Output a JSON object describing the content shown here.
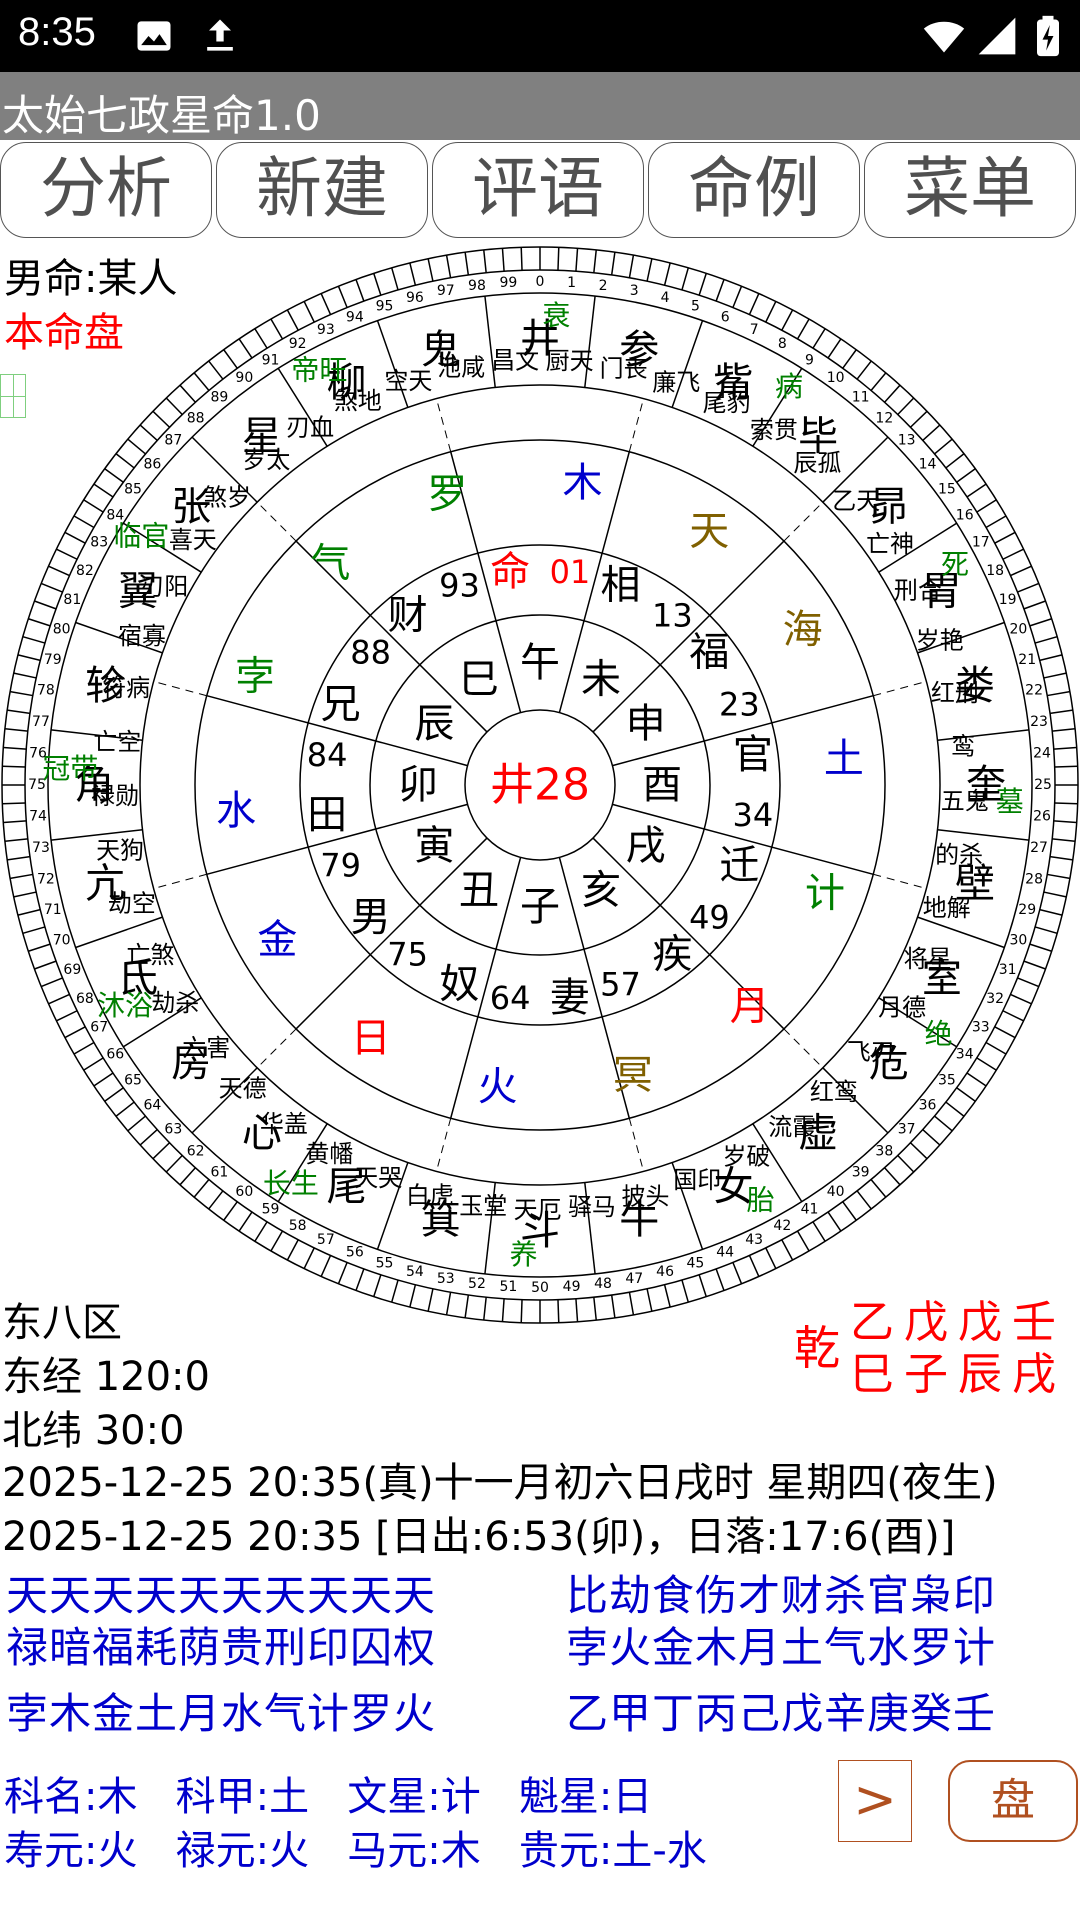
{
  "status_bar": {
    "time": "8:35",
    "icons": [
      "image-icon",
      "upload-icon",
      "wifi-icon",
      "signal-icon",
      "battery-icon"
    ]
  },
  "app": {
    "title": "太始七政星命1.0"
  },
  "tabs": [
    {
      "label": "分析"
    },
    {
      "label": "新建"
    },
    {
      "label": "评语"
    },
    {
      "label": "命例"
    },
    {
      "label": "菜单"
    }
  ],
  "header": {
    "person": "男命:某人",
    "chart_label": "本命盘"
  },
  "chart": {
    "center": "井28",
    "branches": [
      "午",
      "未",
      "申",
      "酉",
      "戌",
      "亥",
      "子",
      "丑",
      "寅",
      "卯",
      "辰",
      "巳"
    ],
    "palaces": [
      {
        "name": "命",
        "age": "01"
      },
      {
        "name": "相",
        "age": "13"
      },
      {
        "name": "福",
        "age": "23"
      },
      {
        "name": "官",
        "age": "34"
      },
      {
        "name": "迁",
        "age": "49"
      },
      {
        "name": "疾",
        "age": "57"
      },
      {
        "name": "妻",
        "age": "64"
      },
      {
        "name": "奴",
        "age": "75"
      },
      {
        "name": "男",
        "age": "79"
      },
      {
        "name": "田",
        "age": "84"
      },
      {
        "name": "兄",
        "age": "88"
      },
      {
        "name": "财",
        "age": "93"
      }
    ],
    "mansions": [
      "井",
      "参",
      "觜",
      "毕",
      "昴",
      "胃",
      "娄",
      "奎",
      "壁",
      "室",
      "危",
      "虚",
      "女",
      "牛",
      "斗",
      "箕",
      "尾",
      "心",
      "房",
      "氐",
      "亢",
      "角",
      "轸",
      "翼",
      "张",
      "星",
      "柳",
      "鬼"
    ],
    "planets": [
      {
        "name": "木",
        "color": "#0000cc"
      },
      {
        "name": "天",
        "color": "#806000"
      },
      {
        "name": "海",
        "color": "#806000"
      },
      {
        "name": "土",
        "color": "#0000cc"
      },
      {
        "name": "计",
        "color": "#008000"
      },
      {
        "name": "月",
        "color": "#ff0000"
      },
      {
        "name": "冥",
        "color": "#806000"
      },
      {
        "name": "火",
        "color": "#0000cc"
      },
      {
        "name": "日",
        "color": "#ff0000"
      },
      {
        "name": "金",
        "color": "#0000cc"
      },
      {
        "name": "水",
        "color": "#0000cc"
      },
      {
        "name": "孛",
        "color": "#008000"
      },
      {
        "name": "气",
        "color": "#008000"
      },
      {
        "name": "罗",
        "color": "#008000"
      }
    ],
    "life_stages": [
      "衰",
      "病",
      "死",
      "墓",
      "绝",
      "胎",
      "养",
      "长生",
      "沐浴",
      "冠带",
      "临官",
      "帝旺"
    ],
    "spirits": [
      {
        "text": "厨天"
      },
      {
        "text": "门丧"
      },
      {
        "text": "廉飞"
      },
      {
        "text": "尾豹"
      },
      {
        "text": "索贯"
      },
      {
        "text": "辰孤"
      },
      {
        "text": "乙天"
      },
      {
        "text": "亡神"
      },
      {
        "text": "刑合"
      },
      {
        "text": "岁艳"
      },
      {
        "text": "红刑"
      },
      {
        "text": "鸾"
      },
      {
        "text": "五鬼"
      },
      {
        "text": "的杀"
      },
      {
        "text": "地解"
      },
      {
        "text": "将星"
      },
      {
        "text": "月德"
      },
      {
        "text": "飞刃"
      },
      {
        "text": "红鸾"
      },
      {
        "text": "流霞"
      },
      {
        "text": "岁破"
      },
      {
        "text": "国印"
      },
      {
        "text": "披头"
      },
      {
        "text": "驿马"
      },
      {
        "text": "天厄"
      },
      {
        "text": "玉堂"
      },
      {
        "text": "白虎"
      },
      {
        "text": "天哭"
      },
      {
        "text": "黄幡"
      },
      {
        "text": "华盖"
      },
      {
        "text": "天德"
      },
      {
        "text": "六害"
      },
      {
        "text": "劫杀"
      },
      {
        "text": "亡煞"
      },
      {
        "text": "劫空"
      },
      {
        "text": "天狗"
      },
      {
        "text": "禄勋"
      },
      {
        "text": "亡空"
      },
      {
        "text": "符病"
      },
      {
        "text": "宿寡"
      },
      {
        "text": "刃阳"
      },
      {
        "text": "喜天"
      },
      {
        "text": "煞岁"
      },
      {
        "text": "岁太"
      },
      {
        "text": "刃血"
      },
      {
        "text": "煞地"
      },
      {
        "text": "空天"
      },
      {
        "text": "池咸"
      },
      {
        "text": "昌文"
      }
    ],
    "outer_degrees": [
      "0",
      "1",
      "2",
      "3",
      "4",
      "5",
      "6",
      "7",
      "8",
      "9",
      "10",
      "11",
      "12",
      "13",
      "14",
      "15",
      "16",
      "17",
      "18",
      "19",
      "20",
      "21",
      "22",
      "23",
      "24",
      "25",
      "26",
      "27",
      "28",
      "29",
      "30",
      "31",
      "32",
      "33",
      "34",
      "35",
      "36",
      "37",
      "38",
      "39",
      "40",
      "41",
      "42",
      "43",
      "44",
      "45",
      "46",
      "47",
      "48",
      "49",
      "50",
      "51",
      "52",
      "53",
      "54",
      "55",
      "56",
      "57",
      "58",
      "59",
      "60",
      "61",
      "62",
      "63",
      "64",
      "65",
      "66",
      "67",
      "68",
      "69",
      "70",
      "71",
      "72",
      "73",
      "74",
      "75",
      "76",
      "77",
      "78",
      "79",
      "80",
      "81",
      "82",
      "83",
      "84",
      "85",
      "86",
      "87",
      "88",
      "89",
      "90",
      "91",
      "92",
      "93",
      "94",
      "95",
      "96",
      "97",
      "98",
      "99"
    ]
  },
  "info": {
    "zone": "东八区",
    "longitude": "东经 120:0",
    "latitude": "北纬 30:0",
    "datetime_true": "2025-12-25 20:35(真)十一月初六日戌时 星期四(夜生)",
    "datetime_sun": "2025-12-25 20:35    [日出:6:53(卯)，日落:17:6(酉)]"
  },
  "bazi": {
    "label": "乾",
    "stems": [
      "乙",
      "戊",
      "戊",
      "壬"
    ],
    "branches": [
      "巳",
      "子",
      "辰",
      "戌"
    ]
  },
  "star_rows": {
    "r1_left": "天天天天天天天天天天",
    "r1_right": "比劫食伤才财杀官枭印",
    "r2_left": "禄暗福耗荫贵刑印囚权",
    "r2_right": "孛火金木月土气水罗计",
    "r3_left": "孛木金土月水气计罗火",
    "r3_right": "乙甲丁丙己戊辛庚癸壬"
  },
  "notes": {
    "line1": "科名:木   科甲:土   文星:计   魁星:日",
    "line2": "寿元:火   禄元:火   马元:木   贵元:土-水"
  },
  "buttons": {
    "next": ">",
    "pan": "盘"
  }
}
